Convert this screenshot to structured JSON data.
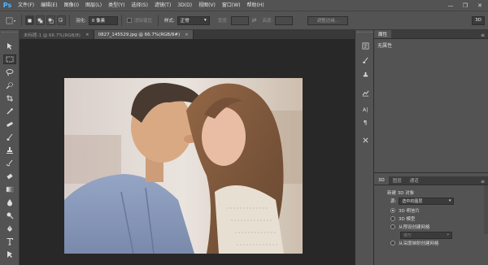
{
  "app": {
    "logo": "Ps"
  },
  "menu": [
    "文件(F)",
    "编辑(E)",
    "图像(I)",
    "图层(L)",
    "类型(Y)",
    "选择(S)",
    "滤镜(T)",
    "3D(D)",
    "视图(V)",
    "窗口(W)",
    "帮助(H)"
  ],
  "window_controls": [
    "—",
    "❐",
    "✕"
  ],
  "options_bar": {
    "feather_label": "羽化:",
    "feather_value": "0 像素",
    "antialias_label": "消除锯齿",
    "style_label": "样式:",
    "style_value": "正常",
    "width_label": "宽度:",
    "height_label": "高度:",
    "refine_edge": "调整边缘...",
    "workspace": "3D"
  },
  "tabs": [
    {
      "label": "未标题-1 @ 66.7%(RGB/8)",
      "close": "×",
      "active": false
    },
    {
      "label": "0827_145529.jpg @ 66.7%(RGB/8#)",
      "close": "×",
      "active": true
    }
  ],
  "panels": {
    "properties_tab": "属性",
    "properties_text": "无属性",
    "bottom_tabs": [
      "3D",
      "图层",
      "通道"
    ],
    "new_3d_object": "新建 3D 对象",
    "source_label": "源:",
    "source_value": "选中的图层",
    "options": [
      {
        "label": "3D 明信片",
        "selected": true
      },
      {
        "label": "3D 模型",
        "selected": false
      },
      {
        "label": "从预设创建网格",
        "selected": false
      },
      {
        "label": "锥形",
        "selected": false
      },
      {
        "label": "从深度映射创建网格",
        "selected": false
      }
    ]
  },
  "colors": {
    "chrome": "#535353",
    "canvas": "#282828",
    "accent": "#4fb7ff"
  }
}
